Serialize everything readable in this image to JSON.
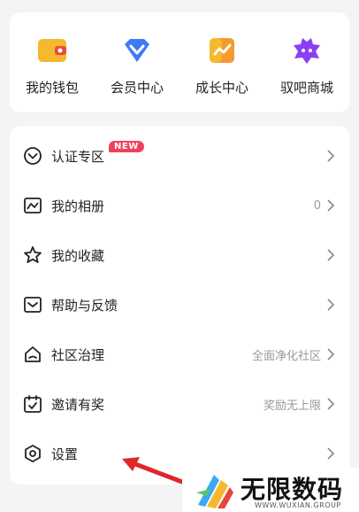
{
  "quick_actions": [
    {
      "label": "我的钱包",
      "icon": "wallet-icon",
      "color": "#f5b82e"
    },
    {
      "label": "会员中心",
      "icon": "vip-diamond-icon",
      "color": "#3d7bf5"
    },
    {
      "label": "成长中心",
      "icon": "growth-chart-icon",
      "color": "#f59a2e"
    },
    {
      "label": "驭吧商城",
      "icon": "mall-bag-icon",
      "color": "#8b3ff5"
    }
  ],
  "menu": {
    "items": [
      {
        "label": "认证专区",
        "value": "",
        "icon": "verified-badge-icon",
        "badge": "NEW"
      },
      {
        "label": "我的相册",
        "value": "0",
        "icon": "album-icon"
      },
      {
        "label": "我的收藏",
        "value": "",
        "icon": "star-icon"
      },
      {
        "label": "帮助与反馈",
        "value": "",
        "icon": "feedback-icon"
      },
      {
        "label": "社区治理",
        "value": "全面净化社区",
        "icon": "community-home-icon"
      },
      {
        "label": "邀请有奖",
        "value": "奖励无上限",
        "icon": "calendar-check-icon"
      },
      {
        "label": "设置",
        "value": "",
        "icon": "settings-gear-icon"
      }
    ]
  },
  "watermark": {
    "title": "无限数码",
    "subtitle": "WWW.WUXIAN.GROUP"
  },
  "colors": {
    "badge": "#f0405b",
    "annotation_arrow": "#e0262b",
    "background": "#f4f4f6"
  }
}
